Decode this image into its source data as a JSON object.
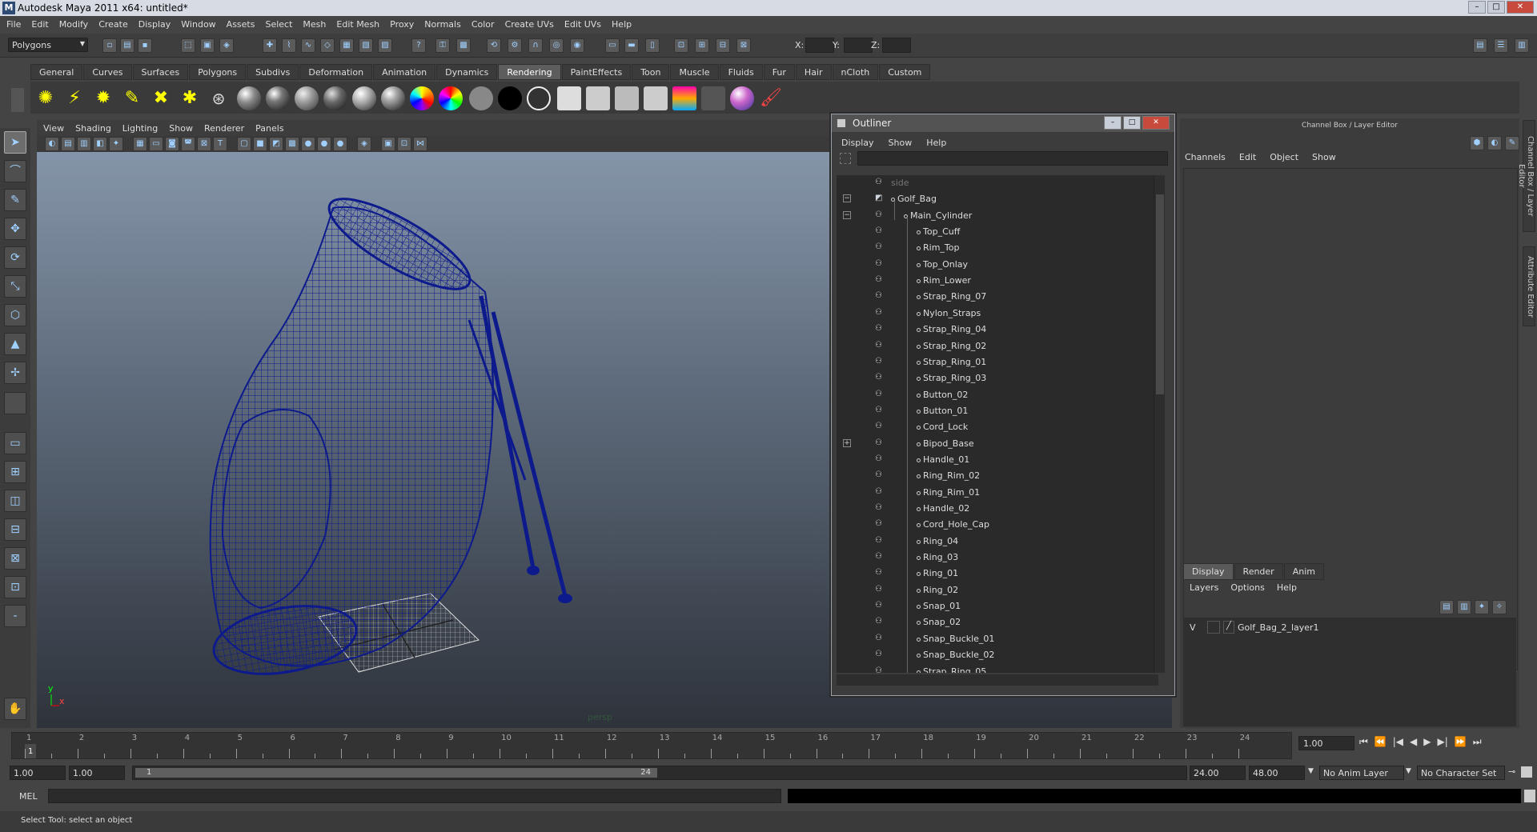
{
  "window": {
    "title": "Autodesk Maya 2011 x64: untitled*",
    "buttons": [
      "–",
      "□",
      "✕"
    ]
  },
  "menubar": [
    "File",
    "Edit",
    "Modify",
    "Create",
    "Display",
    "Window",
    "Assets",
    "Select",
    "Mesh",
    "Edit Mesh",
    "Proxy",
    "Normals",
    "Color",
    "Create UVs",
    "Edit UVs",
    "Help"
  ],
  "statusline": {
    "mode": "Polygons",
    "x_label": "X:",
    "y_label": "Y:",
    "z_label": "Z:"
  },
  "shelf_tabs": [
    "General",
    "Curves",
    "Surfaces",
    "Polygons",
    "Subdivs",
    "Deformation",
    "Animation",
    "Dynamics",
    "Rendering",
    "PaintEffects",
    "Toon",
    "Muscle",
    "Fluids",
    "Fur",
    "Hair",
    "nCloth",
    "Custom"
  ],
  "active_shelf_tab": "Rendering",
  "viewport": {
    "menu": [
      "View",
      "Shading",
      "Lighting",
      "Show",
      "Renderer",
      "Panels"
    ],
    "camera_label": "persp",
    "axis_y": "y",
    "axis_x": "x"
  },
  "outliner": {
    "title": "Outliner",
    "menu": [
      "Display",
      "Show",
      "Help"
    ],
    "items": [
      {
        "name": "side",
        "level": 0,
        "dim": true
      },
      {
        "name": "Golf_Bag",
        "level": 0,
        "expander": "−"
      },
      {
        "name": "Main_Cylinder",
        "level": 1,
        "expander": "−"
      },
      {
        "name": "Top_Cuff",
        "level": 2
      },
      {
        "name": "Rim_Top",
        "level": 2
      },
      {
        "name": "Top_Onlay",
        "level": 2
      },
      {
        "name": "Rim_Lower",
        "level": 2
      },
      {
        "name": "Strap_Ring_07",
        "level": 2
      },
      {
        "name": "Nylon_Straps",
        "level": 2
      },
      {
        "name": "Strap_Ring_04",
        "level": 2
      },
      {
        "name": "Strap_Ring_02",
        "level": 2
      },
      {
        "name": "Strap_Ring_01",
        "level": 2
      },
      {
        "name": "Strap_Ring_03",
        "level": 2
      },
      {
        "name": "Button_02",
        "level": 2
      },
      {
        "name": "Button_01",
        "level": 2
      },
      {
        "name": "Cord_Lock",
        "level": 2
      },
      {
        "name": "Bipod_Base",
        "level": 2,
        "expander": "+"
      },
      {
        "name": "Handle_01",
        "level": 2
      },
      {
        "name": "Ring_Rim_02",
        "level": 2
      },
      {
        "name": "Ring_Rim_01",
        "level": 2
      },
      {
        "name": "Handle_02",
        "level": 2
      },
      {
        "name": "Cord_Hole_Cap",
        "level": 2
      },
      {
        "name": "Ring_04",
        "level": 2
      },
      {
        "name": "Ring_03",
        "level": 2
      },
      {
        "name": "Ring_01",
        "level": 2
      },
      {
        "name": "Ring_02",
        "level": 2
      },
      {
        "name": "Snap_01",
        "level": 2
      },
      {
        "name": "Snap_02",
        "level": 2
      },
      {
        "name": "Snap_Buckle_01",
        "level": 2
      },
      {
        "name": "Snap_Buckle_02",
        "level": 2
      },
      {
        "name": "Strap_Ring_05",
        "level": 2
      }
    ]
  },
  "channelbox": {
    "title": "Channel Box / Layer Editor",
    "menu": [
      "Channels",
      "Edit",
      "Object",
      "Show"
    ],
    "layer_tabs": [
      "Display",
      "Render",
      "Anim"
    ],
    "active_layer_tab": "Display",
    "layer_menu": [
      "Layers",
      "Options",
      "Help"
    ],
    "layers": [
      {
        "visible": "V",
        "name": "Golf_Bag_2_layer1"
      }
    ]
  },
  "side_tabs": [
    "Channel Box / Layer Editor",
    "Attribute Editor"
  ],
  "timeslider": {
    "ticks": [
      1,
      2,
      3,
      4,
      5,
      6,
      7,
      8,
      9,
      10,
      11,
      12,
      13,
      14,
      15,
      16,
      17,
      18,
      19,
      20,
      21,
      22,
      23,
      24
    ],
    "current_frame_label": "1",
    "current_frame": "1.00"
  },
  "playback_icons": [
    "⏮",
    "⏪",
    "|◀",
    "◀",
    "▶",
    "▶|",
    "⏩",
    "⏭"
  ],
  "range": {
    "start": "1.00",
    "start2": "1.00",
    "bar_start": "1",
    "bar_end": "24",
    "end": "24.00",
    "end2": "48.00",
    "anim_layer": "No Anim Layer",
    "char_set": "No Character Set"
  },
  "cmdline": {
    "label": "MEL"
  },
  "helpline": {
    "text": "Select Tool: select an object"
  },
  "colors": {
    "wireframe": "#0d1a8c",
    "accent": "#5d5d5d"
  }
}
